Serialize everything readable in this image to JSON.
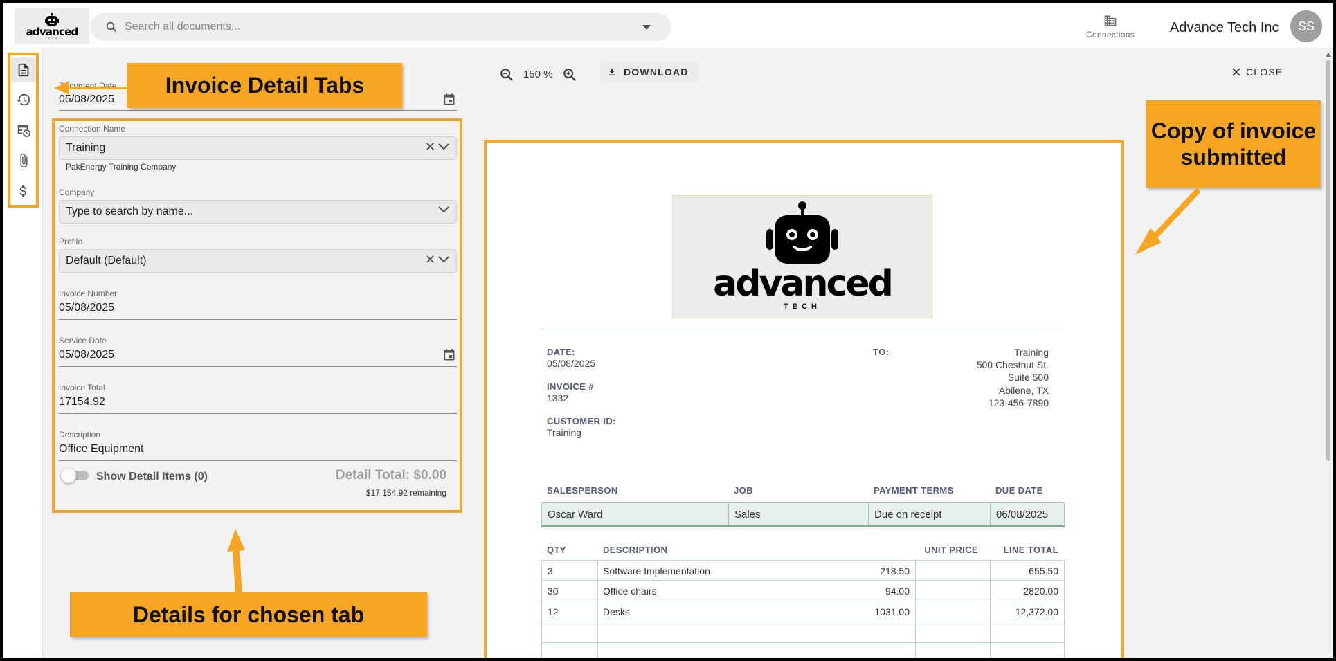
{
  "header": {
    "logo_word": "advanced",
    "logo_sub": "TECH",
    "search_placeholder": "Search all documents...",
    "connections_label": "Connections",
    "company_name": "Advance Tech Inc",
    "avatar_initials": "SS"
  },
  "rail": {
    "items": [
      {
        "icon": "document-icon",
        "active": true
      },
      {
        "icon": "history-icon",
        "active": false
      },
      {
        "icon": "table-clock-icon",
        "active": false
      },
      {
        "icon": "paperclip-icon",
        "active": false
      },
      {
        "icon": "dollar-icon",
        "active": false
      }
    ]
  },
  "form": {
    "document_date_label": "Document Date",
    "document_date_value": "05/08/2025",
    "connection_name_label": "Connection Name",
    "connection_name_value": "Training",
    "connection_name_sub": "PakEnergy Training Company",
    "company_label": "Company",
    "company_placeholder": "Type to search by name...",
    "profile_label": "Profile",
    "profile_value": "Default (Default)",
    "invoice_number_label": "Invoice Number",
    "invoice_number_value": "05/08/2025",
    "service_date_label": "Service Date",
    "service_date_value": "05/08/2025",
    "invoice_total_label": "Invoice Total",
    "invoice_total_value": "17154.92",
    "description_label": "Description",
    "description_value": "Office Equipment",
    "show_detail_items_label": "Show Detail Items (0)",
    "show_detail_items_on": false,
    "detail_total": "Detail Total: $0.00",
    "remaining": "$17,154.92 remaining"
  },
  "viewer": {
    "zoom": "150 %",
    "download_label": "DOWNLOAD",
    "close_label": "CLOSE"
  },
  "invoice": {
    "logo_word": "advanced",
    "logo_sub": "TECH",
    "date_label": "DATE:",
    "date_value": "05/08/2025",
    "invoice_label": "INVOICE #",
    "invoice_value": "1332",
    "customer_label": "CUSTOMER ID:",
    "customer_value": "Training",
    "to_label": "TO:",
    "to_lines": [
      "Training",
      "500 Chestnut St.",
      "Suite 500",
      "Abilene, TX",
      "123-456-7890"
    ],
    "sales_headers": [
      "SALESPERSON",
      "JOB",
      "PAYMENT TERMS",
      "DUE DATE"
    ],
    "sales_values": [
      "Oscar Ward",
      "Sales",
      "Due on receipt",
      "06/08/2025"
    ],
    "item_headers": [
      "QTY",
      "DESCRIPTION",
      "UNIT PRICE",
      "LINE TOTAL"
    ],
    "items": [
      {
        "qty": "3",
        "description": "Software Implementation",
        "unit_price": "218.50",
        "line_total": "655.50"
      },
      {
        "qty": "30",
        "description": "Office chairs",
        "unit_price": "94.00",
        "line_total": "2820.00"
      },
      {
        "qty": "12",
        "description": "Desks",
        "unit_price": "1031.00",
        "line_total": "12,372.00"
      },
      {
        "qty": "",
        "description": "",
        "unit_price": "",
        "line_total": ""
      },
      {
        "qty": "",
        "description": "",
        "unit_price": "",
        "line_total": ""
      }
    ]
  },
  "annotations": {
    "tabs_callout": "Invoice Detail Tabs",
    "copy_callout": "Copy of invoice submitted",
    "details_callout": "Details for chosen tab"
  },
  "colors": {
    "callout": "#f6a623",
    "invoice_heading": "#55597a",
    "table_line": "#a9c5b5"
  }
}
